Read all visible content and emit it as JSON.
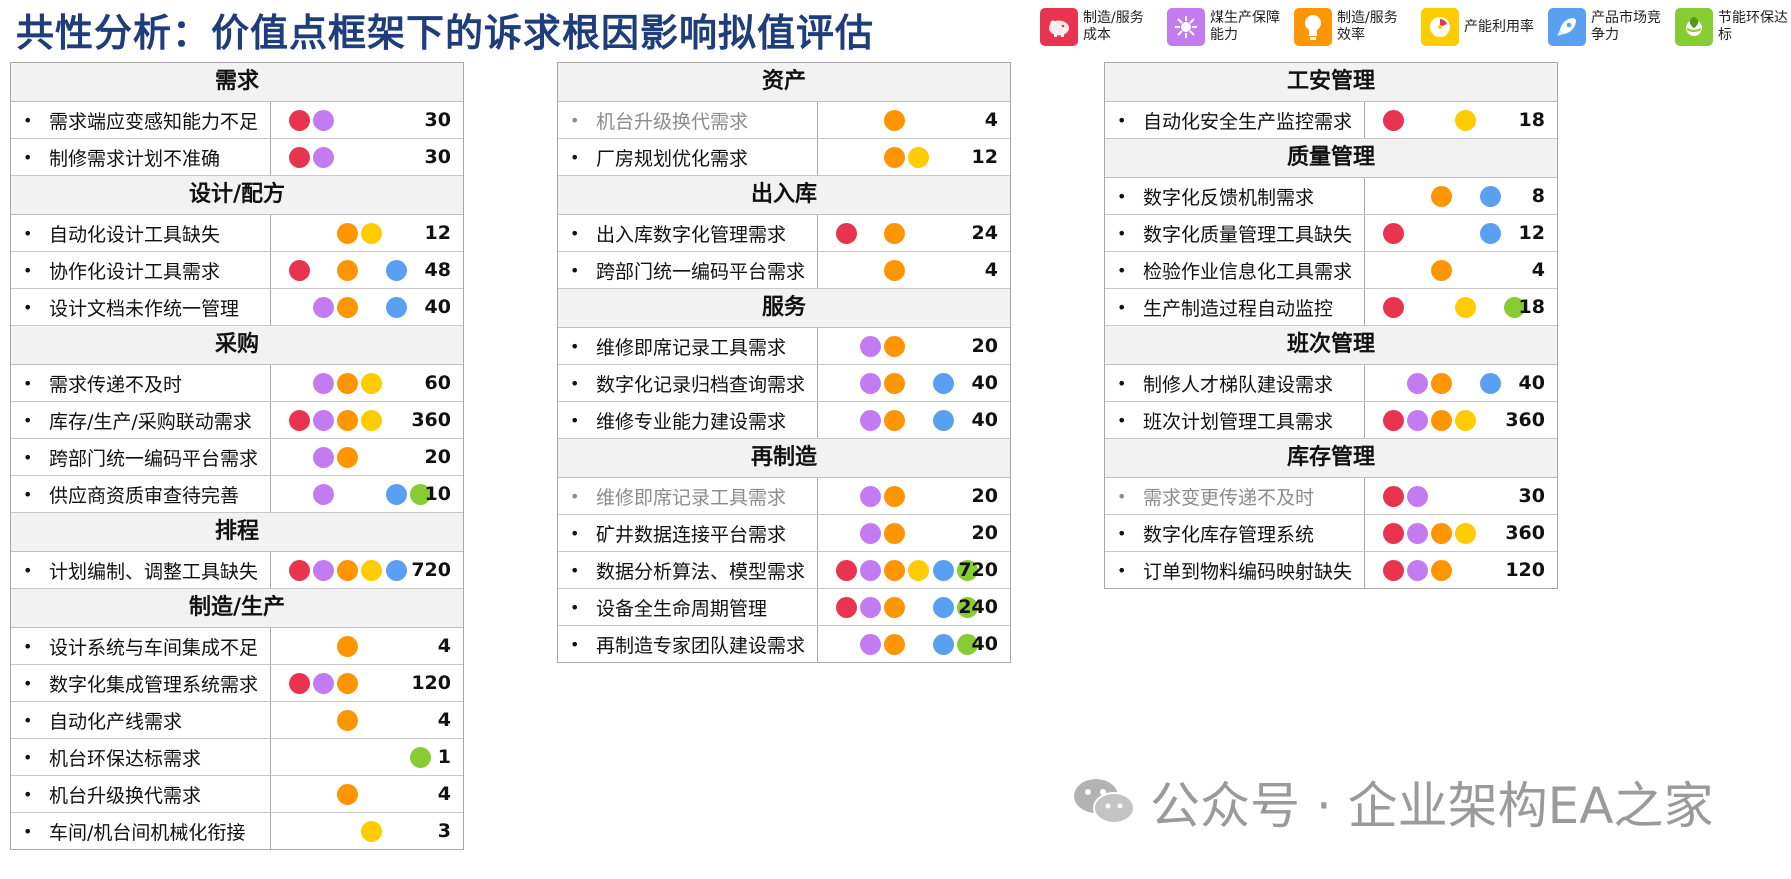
{
  "title": "共性分析：价值点框架下的诉求根因影响拟值评估",
  "value_points": [
    {
      "key": "cost",
      "label": "制造/服务成本",
      "color": "#e8344e",
      "icon": "piggy-bank-icon"
    },
    {
      "key": "coal",
      "label": "煤生产保障能力",
      "color": "#c27bf0",
      "icon": "gear-network-icon"
    },
    {
      "key": "eff",
      "label": "制造/服务效率",
      "color": "#ff9500",
      "icon": "lightbulb-icon"
    },
    {
      "key": "util",
      "label": "产能利用率",
      "color": "#ffcc00",
      "icon": "gauge-icon"
    },
    {
      "key": "market",
      "label": "产品市场竞争力",
      "color": "#5aa0f0",
      "icon": "rocket-icon"
    },
    {
      "key": "green",
      "label": "节能环保达标",
      "color": "#88cc33",
      "icon": "leaf-globe-icon"
    }
  ],
  "columns": [
    {
      "sections": [
        {
          "title": "需求",
          "rows": [
            {
              "label": "需求端应变感知能力不足",
              "dots": [
                "cost",
                "coal"
              ],
              "score": "30"
            },
            {
              "label": "制修需求计划不准确",
              "dots": [
                "cost",
                "coal"
              ],
              "score": "30"
            }
          ]
        },
        {
          "title": "设计/配方",
          "rows": [
            {
              "label": "自动化设计工具缺失",
              "dots": [
                "eff",
                "util"
              ],
              "score": "12"
            },
            {
              "label": "协作化设计工具需求",
              "dots": [
                "cost",
                "eff",
                "market"
              ],
              "score": "48"
            },
            {
              "label": "设计文档未作统一管理",
              "dots": [
                "coal",
                "eff",
                "market"
              ],
              "score": "40"
            }
          ]
        },
        {
          "title": "采购",
          "rows": [
            {
              "label": "需求传递不及时",
              "dots": [
                "coal",
                "eff",
                "util"
              ],
              "score": "60"
            },
            {
              "label": "库存/生产/采购联动需求",
              "dots": [
                "cost",
                "coal",
                "eff",
                "util"
              ],
              "score": "360"
            },
            {
              "label": "跨部门统一编码平台需求",
              "dots": [
                "coal",
                "eff"
              ],
              "score": "20"
            },
            {
              "label": "供应商资质审查待完善",
              "dots": [
                "coal",
                "market",
                "green"
              ],
              "score": "10"
            }
          ]
        },
        {
          "title": "排程",
          "rows": [
            {
              "label": "计划编制、调整工具缺失",
              "dots": [
                "cost",
                "coal",
                "eff",
                "util",
                "market"
              ],
              "score": "720"
            }
          ]
        },
        {
          "title": "制造/生产",
          "rows": [
            {
              "label": "设计系统与车间集成不足",
              "dots": [
                "eff"
              ],
              "score": "4"
            },
            {
              "label": "数字化集成管理系统需求",
              "dots": [
                "cost",
                "coal",
                "eff"
              ],
              "score": "120"
            },
            {
              "label": "自动化产线需求",
              "dots": [
                "eff"
              ],
              "score": "4"
            },
            {
              "label": "机台环保达标需求",
              "dots": [
                "green"
              ],
              "score": "1"
            },
            {
              "label": "机台升级换代需求",
              "dots": [
                "eff"
              ],
              "score": "4"
            },
            {
              "label": "车间/机台间机械化衔接",
              "dots": [
                "util"
              ],
              "score": "3"
            }
          ]
        }
      ]
    },
    {
      "sections": [
        {
          "title": "资产",
          "rows": [
            {
              "label": "机台升级换代需求",
              "dots": [
                "eff"
              ],
              "score": "4",
              "muted": true
            },
            {
              "label": "厂房规划优化需求",
              "dots": [
                "eff",
                "util"
              ],
              "score": "12"
            }
          ]
        },
        {
          "title": "出入库",
          "rows": [
            {
              "label": "出入库数字化管理需求",
              "dots": [
                "cost",
                "eff"
              ],
              "score": "24"
            },
            {
              "label": "跨部门统一编码平台需求",
              "dots": [
                "eff"
              ],
              "score": "4"
            }
          ]
        },
        {
          "title": "服务",
          "rows": [
            {
              "label": "维修即席记录工具需求",
              "dots": [
                "coal",
                "eff"
              ],
              "score": "20"
            },
            {
              "label": "数字化记录归档查询需求",
              "dots": [
                "coal",
                "eff",
                "market"
              ],
              "score": "40"
            },
            {
              "label": "维修专业能力建设需求",
              "dots": [
                "coal",
                "eff",
                "market"
              ],
              "score": "40"
            }
          ]
        },
        {
          "title": "再制造",
          "rows": [
            {
              "label": "维修即席记录工具需求",
              "dots": [
                "coal",
                "eff"
              ],
              "score": "20",
              "muted": true
            },
            {
              "label": "矿井数据连接平台需求",
              "dots": [
                "coal",
                "eff"
              ],
              "score": "20"
            },
            {
              "label": "数据分析算法、模型需求",
              "dots": [
                "cost",
                "coal",
                "eff",
                "util",
                "market",
                "green"
              ],
              "score": "720"
            },
            {
              "label": "设备全生命周期管理",
              "dots": [
                "cost",
                "coal",
                "eff",
                "market",
                "green"
              ],
              "score": "240"
            },
            {
              "label": "再制造专家团队建设需求",
              "dots": [
                "coal",
                "eff",
                "market",
                "green"
              ],
              "score": "40"
            }
          ]
        }
      ]
    },
    {
      "sections": [
        {
          "title": "工安管理",
          "rows": [
            {
              "label": "自动化安全生产监控需求",
              "dots": [
                "cost",
                "util"
              ],
              "score": "18"
            }
          ]
        },
        {
          "title": "质量管理",
          "rows": [
            {
              "label": "数字化反馈机制需求",
              "dots": [
                "eff",
                "market"
              ],
              "score": "8"
            },
            {
              "label": "数字化质量管理工具缺失",
              "dots": [
                "cost",
                "market"
              ],
              "score": "12"
            },
            {
              "label": "检验作业信息化工具需求",
              "dots": [
                "eff"
              ],
              "score": "4"
            },
            {
              "label": "生产制造过程自动监控",
              "dots": [
                "cost",
                "util",
                "green"
              ],
              "score": "18"
            }
          ]
        },
        {
          "title": "班次管理",
          "rows": [
            {
              "label": "制修人才梯队建设需求",
              "dots": [
                "coal",
                "eff",
                "market"
              ],
              "score": "40"
            },
            {
              "label": "班次计划管理工具需求",
              "dots": [
                "cost",
                "coal",
                "eff",
                "util"
              ],
              "score": "360"
            }
          ]
        },
        {
          "title": "库存管理",
          "rows": [
            {
              "label": "需求变更传递不及时",
              "dots": [
                "cost",
                "coal"
              ],
              "score": "30",
              "muted": true
            },
            {
              "label": "数字化库存管理系统",
              "dots": [
                "cost",
                "coal",
                "eff",
                "util"
              ],
              "score": "360"
            },
            {
              "label": "订单到物料编码映射缺失",
              "dots": [
                "cost",
                "coal",
                "eff"
              ],
              "score": "120"
            }
          ]
        }
      ]
    }
  ],
  "watermark": {
    "text": "公众号 · 企业架构EA之家",
    "icon": "wechat-icon"
  }
}
